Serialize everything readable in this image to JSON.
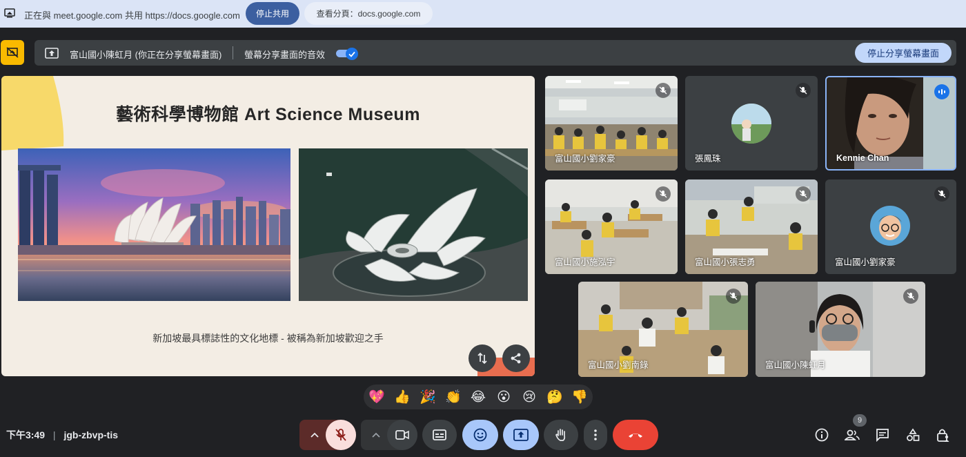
{
  "share_bar": {
    "sharing_text": "正在與 meet.google.com 共用 https://docs.google.com",
    "stop_label": "停止共用",
    "view_tab_label": "查看分頁：docs.google.com"
  },
  "present_banner": {
    "presenter_text": "富山國小陳虹月 (你正在分享螢幕畫面)",
    "audio_label": "螢幕分享畫面的音效",
    "audio_toggle_on": true,
    "stop_present_label": "停止分享螢幕畫面"
  },
  "slide": {
    "title": "藝術科學博物館 Art Science Museum",
    "caption": "新加坡最具標誌性的文化地標 - 被稱為新加坡歡迎之手"
  },
  "participants": [
    {
      "name": "富山國小劉家豪",
      "muted": true
    },
    {
      "name": "張鳳珠",
      "muted": true
    },
    {
      "name": "Kennie Chan",
      "muted": false,
      "speaking": true
    },
    {
      "name": "富山國小施泓宇",
      "muted": true
    },
    {
      "name": "富山國小張志勇",
      "muted": true
    },
    {
      "name": "富山國小劉家豪",
      "muted": true
    },
    {
      "name": "富山國小劉南錄",
      "muted": true
    },
    {
      "name": "富山國小陳虹月",
      "muted": true
    }
  ],
  "reactions": [
    "💖",
    "👍",
    "🎉",
    "👏",
    "😂",
    "😮",
    "😢",
    "🤔",
    "👎"
  ],
  "bottom_bar": {
    "time": "下午3:49",
    "meeting_code": "jgb-zbvp-tis",
    "participant_count": "9"
  },
  "colors": {
    "end_call": "#ea4335",
    "accent_blue": "#a8c7fa",
    "mic_off_bg": "#f9dedc",
    "speaking_border": "#8ab4f8"
  }
}
